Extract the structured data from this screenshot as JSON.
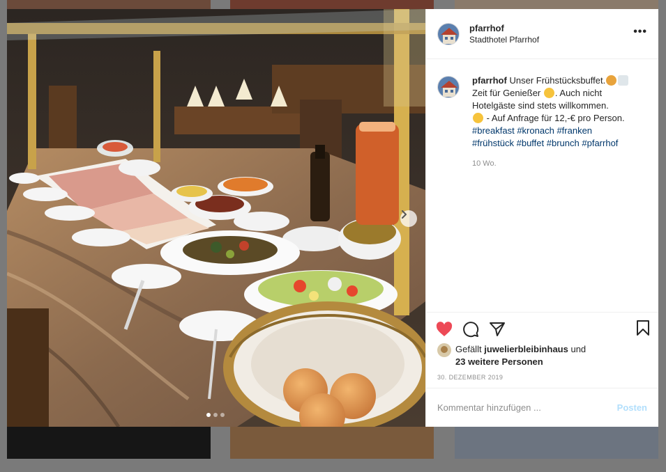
{
  "post": {
    "username": "pfarrhof",
    "location": "Stadthotel Pfarrhof",
    "more_icon": "more-horizontal-icon",
    "caption_parts": {
      "line1": "Unser Frühstücksbuffet.",
      "line2": "Zeit für Genießer",
      "line2b": ". Auch nicht",
      "line3": "Hotelgäste sind stets willkommen.",
      "line4": " - Auf Anfrage für 12,-€ pro Person."
    },
    "hashtags": [
      "#breakfast",
      "#kronach",
      "#franken",
      "#frühstück",
      "#buffet",
      "#brunch",
      "#pfarrhof"
    ],
    "age": "10 Wo.",
    "liked_by": "juwelierbleibinhaus",
    "likes_prefix": "Gefällt",
    "likes_and": "und",
    "others": "23 weitere Personen",
    "date": "30. DEZEMBER 2019"
  },
  "comment_box": {
    "placeholder": "Kommentar hinzufügen ...",
    "post_label": "Posten"
  },
  "carousel": {
    "total": 3,
    "active": 0
  },
  "colors": {
    "heart": "#ed4956",
    "link": "#00376b",
    "post_disabled": "#b2dffc"
  }
}
